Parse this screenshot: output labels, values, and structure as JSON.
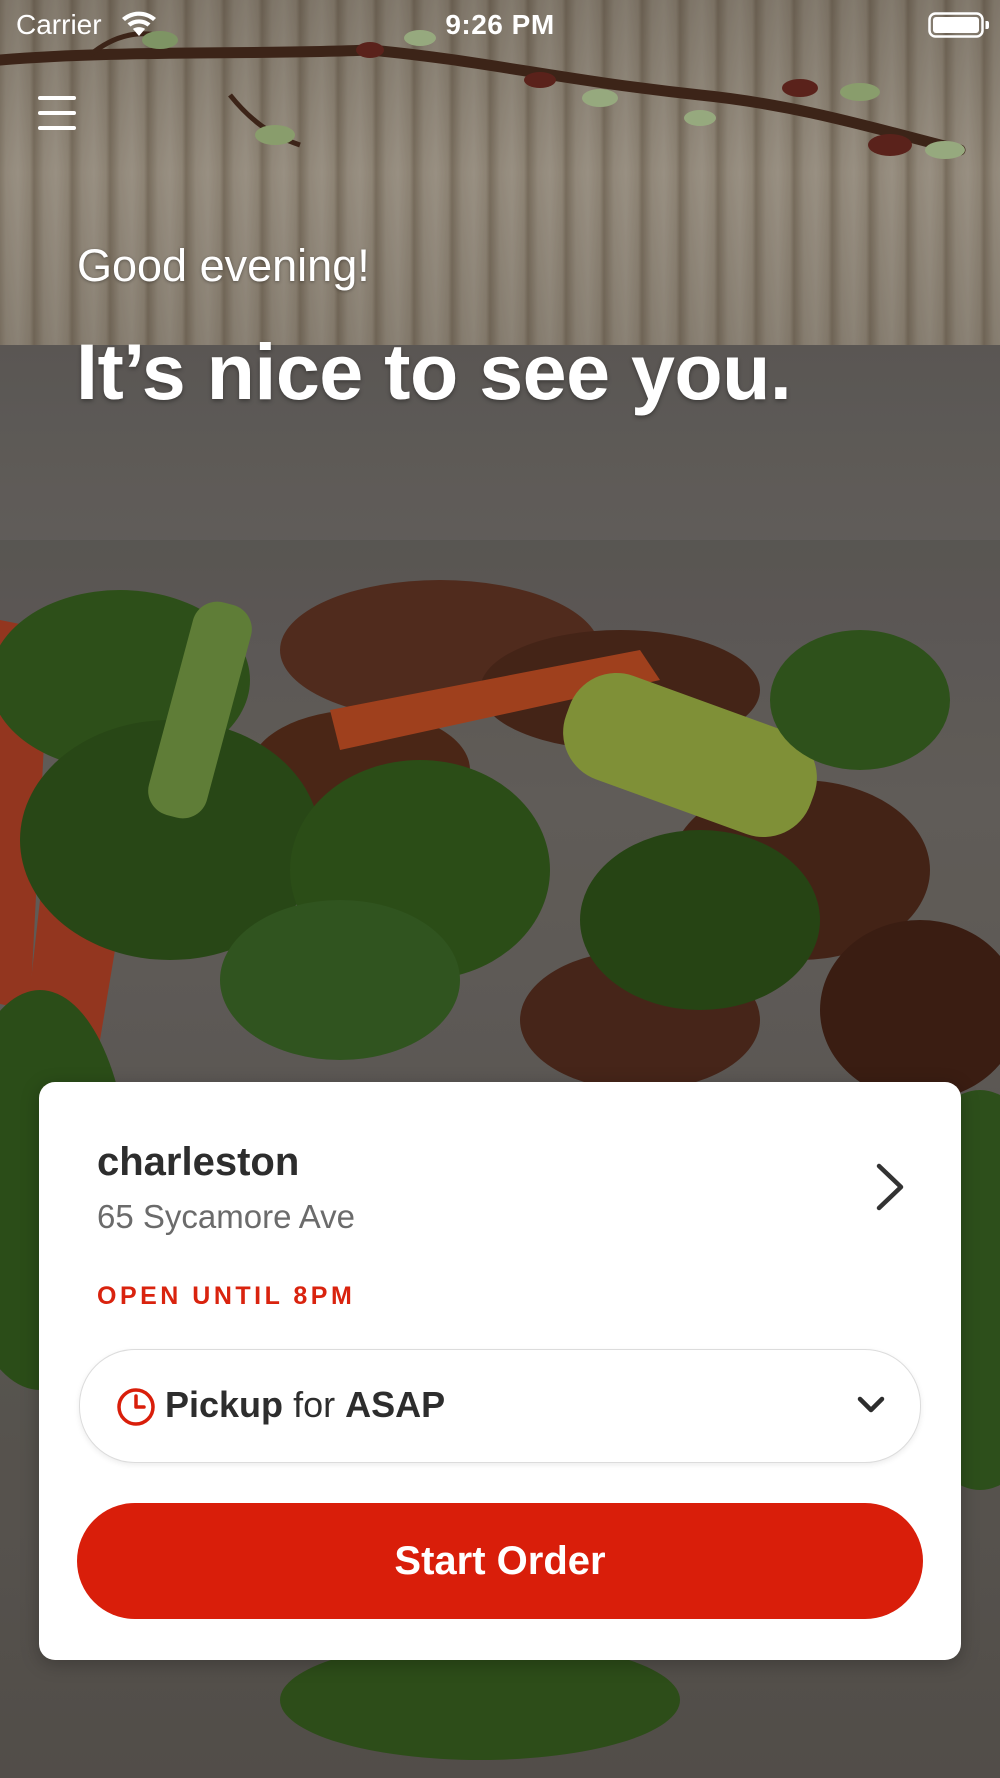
{
  "status_bar": {
    "carrier": "Carrier",
    "time": "9:26 PM"
  },
  "menu": {
    "icon": "hamburger-menu-icon"
  },
  "hero": {
    "greeting": "Good evening!",
    "headline": "It’s nice to see you."
  },
  "location": {
    "name": "charleston",
    "address": "65 Sycamore Ave",
    "open_status": "OPEN UNTIL 8PM"
  },
  "order_mode": {
    "mode": "Pickup",
    "connector": "for",
    "time": "ASAP",
    "icon": "clock-icon"
  },
  "actions": {
    "start_order_label": "Start Order"
  },
  "colors": {
    "accent": "#d91e0a",
    "card": "#ffffff",
    "text_primary": "#2d2d2d",
    "text_secondary": "#6b6b6b"
  }
}
